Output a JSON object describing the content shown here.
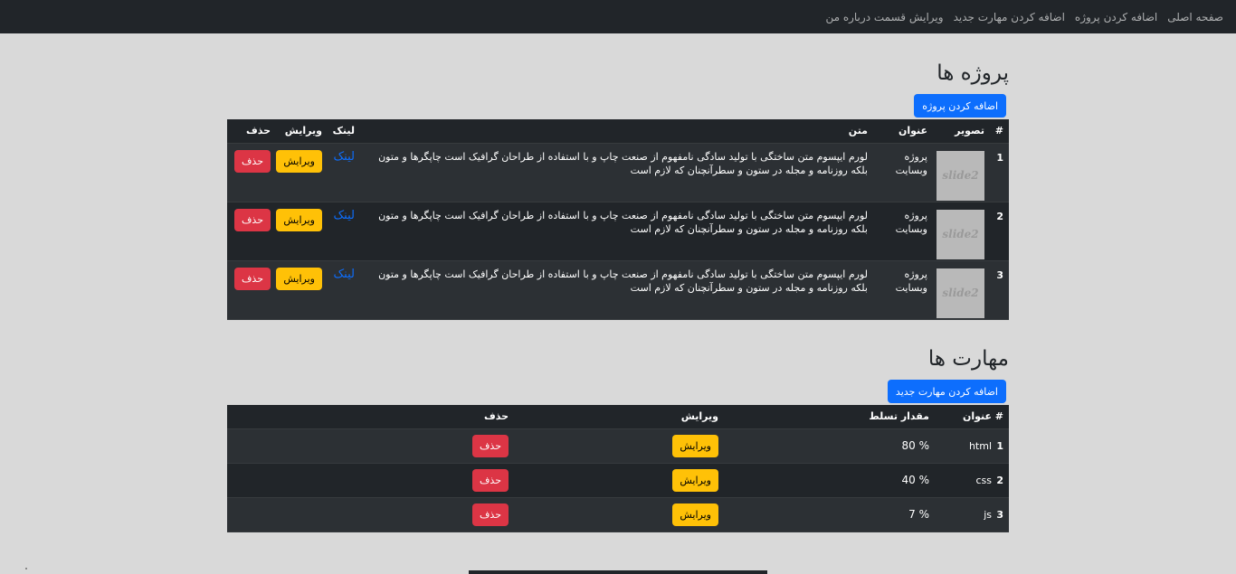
{
  "nav": {
    "items": [
      "صفحه اصلی",
      "اضافه کردن پروژه",
      "اضافه کردن مهارت جدید",
      "ویرایش قسمت درباره من"
    ]
  },
  "projects": {
    "title": "پروژه ها",
    "add_label": "اضافه کردن پروژه",
    "headers": [
      "#",
      "تصویر",
      "عنوان",
      "متن",
      "لینک",
      "ویرایش",
      "حذف"
    ],
    "rows": [
      {
        "index": "1",
        "image_text": "slide2",
        "title": "پروژه وبسایت",
        "text": "لورم ایپسوم متن ساختگی با تولید سادگی نامفهوم از صنعت چاپ و با استفاده از طراحان گرافیک است چاپگرها و متون بلکه روزنامه و مجله در ستون و سطرآنچنان که لازم است",
        "link": "لینک",
        "edit": "ویرایش",
        "delete": "حذف"
      },
      {
        "index": "2",
        "image_text": "slide2",
        "title": "پروژه وبسایت",
        "text": "لورم ایپسوم متن ساختگی با تولید سادگی نامفهوم از صنعت چاپ و با استفاده از طراحان گرافیک است چاپگرها و متون بلکه روزنامه و مجله در ستون و سطرآنچنان که لازم است",
        "link": "لینک",
        "edit": "ویرایش",
        "delete": "حذف"
      },
      {
        "index": "3",
        "image_text": "slide2",
        "title": "پروژه وبسایت",
        "text": "لورم ایپسوم متن ساختگی با تولید سادگی نامفهوم از صنعت چاپ و با استفاده از طراحان گرافیک است چاپگرها و متون بلکه روزنامه و مجله در ستون و سطرآنچنان که لازم است",
        "link": "لینک",
        "edit": "ویرایش",
        "delete": "حذف"
      }
    ]
  },
  "skills": {
    "title": "مهارت ها",
    "add_label": "اضافه کردن مهارت جدید",
    "headers": [
      "#",
      "عنوان",
      "مقدار تسلط",
      "ویرایش",
      "حذف"
    ],
    "rows": [
      {
        "index": "1",
        "title": "html",
        "level": "80 %",
        "edit": "ویرایش",
        "delete": "حذف"
      },
      {
        "index": "2",
        "title": "css",
        "level": "40 %",
        "edit": "ویرایش",
        "delete": "حذف"
      },
      {
        "index": "3",
        "title": "js",
        "level": "7 %",
        "edit": "ویرایش",
        "delete": "حذف"
      }
    ]
  },
  "colors": {
    "navbar": "#212529",
    "background": "#d9d9d9",
    "primary": "#0d6efd",
    "warning": "#ffc107",
    "danger": "#dc3545"
  }
}
